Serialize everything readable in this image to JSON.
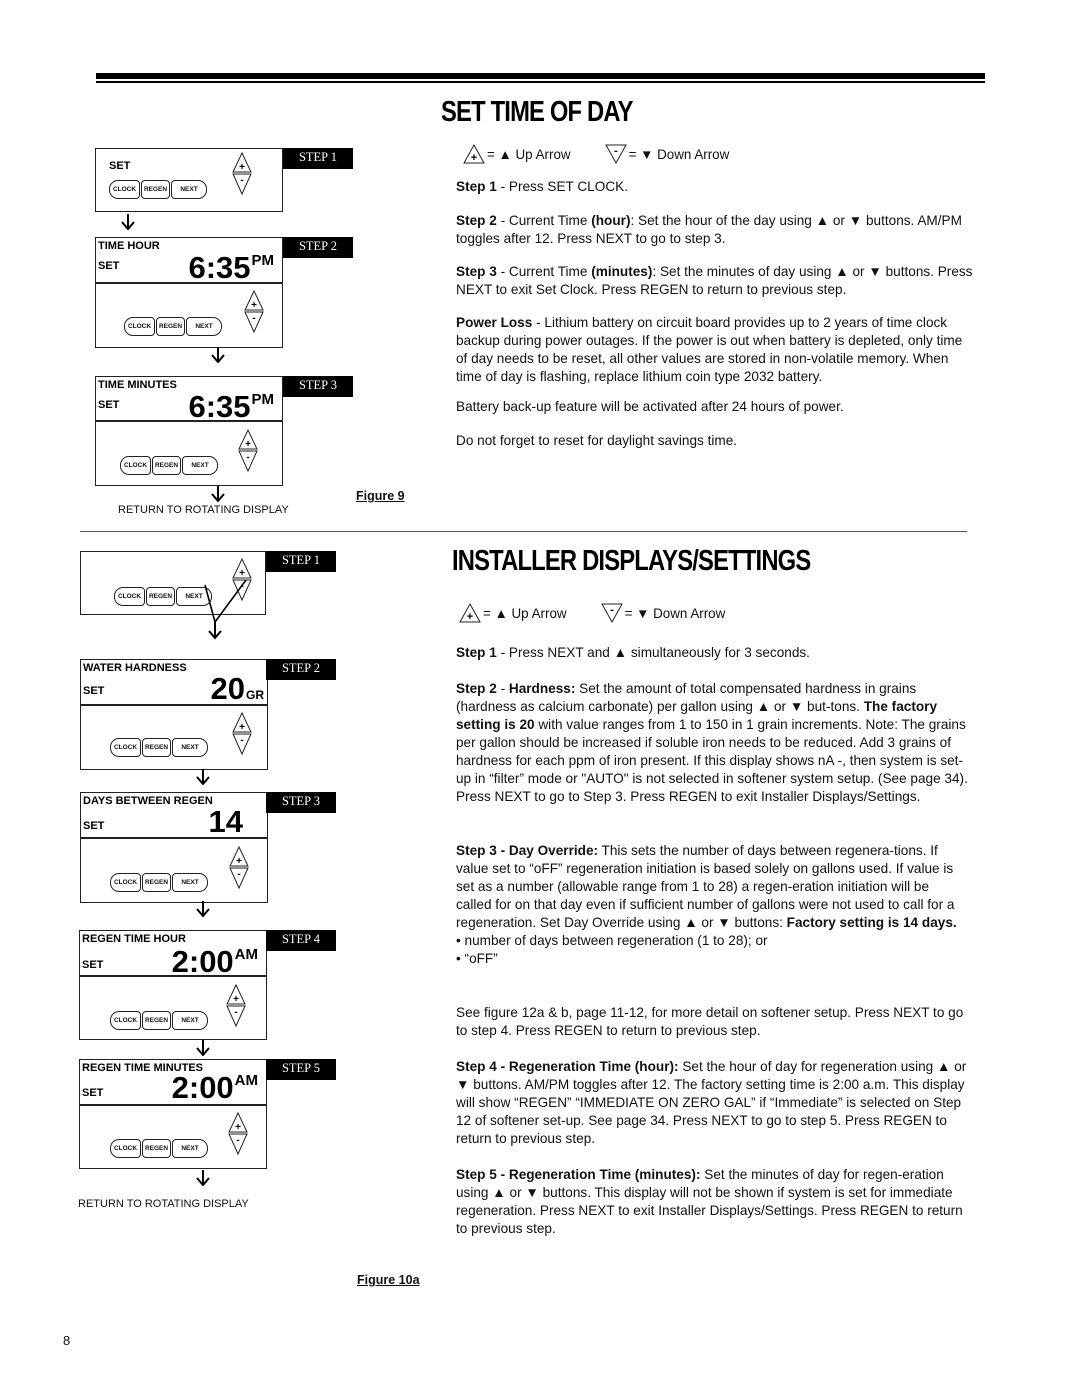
{
  "page_number": "8",
  "legend": {
    "up_label": "= ▲ Up Arrow",
    "down_label": "= ▼ Down Arrow"
  },
  "buttons": {
    "clock": "CLOCK",
    "regen": "REGEN",
    "next": "NEXT",
    "plus": "+",
    "minus": "-"
  },
  "set_time_of_day": {
    "heading": "SET TIME OF DAY",
    "figure_label": "Figure 9",
    "return_text": "RETURN TO ROTATING DISPLAY",
    "panels": [
      {
        "step": "STEP 1",
        "line1": "",
        "line2": "SET",
        "value": "",
        "suffix": ""
      },
      {
        "step": "STEP 2",
        "line1": "TIME  HOUR",
        "line2": "SET",
        "value": "6:35",
        "suffix": "PM"
      },
      {
        "step": "STEP 3",
        "line1": "TIME  MINUTES",
        "line2": "SET",
        "value": "6:35",
        "suffix": "PM"
      }
    ],
    "paragraphs": {
      "step1_label": "Step 1",
      "step1_text": " - Press SET CLOCK.",
      "step2_label": "Step 2",
      "step2_text_a": " - Current Time ",
      "step2_bold": "(hour)",
      "step2_text_b": ": Set the hour of the day using ▲ or ▼ buttons. AM/PM toggles after 12.  Press NEXT to go to step 3.",
      "step3_label": "Step 3",
      "step3_text_a": " - Current Time ",
      "step3_bold": "(minutes)",
      "step3_text_b": ": Set the minutes of day using ▲ or ▼ buttons. Press NEXT to exit Set Clock.  Press REGEN to return to previous step.",
      "power_label": "Power Loss",
      "power_text": " - Lithium battery on circuit board provides up to 2 years of time clock backup during power outages.  If the power is out when battery is depleted, only time of day needs to be reset, all other values are stored in non-volatile memory.  When time of day is flashing, replace lithium coin type 2032 battery.",
      "battery_text": "Battery back-up feature will be activated after 24 hours of power.",
      "dst_text": "Do not forget to reset for daylight savings time."
    }
  },
  "installer": {
    "heading": "INSTALLER DISPLAYS/SETTINGS",
    "figure_label": "Figure 10a",
    "return_text": "RETURN TO ROTATING DISPLAY",
    "panels": [
      {
        "step": "STEP 1",
        "line1": "",
        "line2": "",
        "value": "",
        "suffix": ""
      },
      {
        "step": "STEP 2",
        "line1": "WATER   HARDNESS",
        "line2": "SET",
        "value": "20",
        "suffix": "GR"
      },
      {
        "step": "STEP 3",
        "line1": "DAYS BETWEEN REGEN",
        "line2": "SET",
        "value": "14",
        "suffix": ""
      },
      {
        "step": "STEP 4",
        "line1": "REGEN TIME HOUR",
        "line2": "SET",
        "value": "2:00",
        "suffix": "AM"
      },
      {
        "step": "STEP 5",
        "line1": "REGEN TIME MINUTES",
        "line2": "SET",
        "value": "2:00",
        "suffix": "AM"
      }
    ],
    "paragraphs": {
      "step1_label": "Step 1",
      "step1_text": " - Press NEXT and ▲ simultaneously for 3 seconds.",
      "step2_label": "Step 2",
      "step2_text_a": " - ",
      "step2_bold_a": "Hardness:",
      "step2_text_b": "  Set the amount of total compensated hardness in grains (hardness as calcium carbonate) per gallon using ▲ or ▼ but-tons. ",
      "step2_bold_b": "The factory setting is 20",
      "step2_text_c": " with value ranges from 1 to 150 in 1 grain increments.  Note:  The grains per gallon should be increased if soluble iron needs to be reduced.    Add 3 grains of hardness for each ppm of iron present.  If this display shows nA -, then system is set-up in “filter” mode or \"AUTO\" is not selected in softener system setup.  (See page 34).  Press NEXT to go to Step 3.  Press REGEN to exit Installer Displays/Settings.",
      "step3_bold": "Step 3 - Day Override:",
      "step3_text": "  This sets the number of days between regenera-tions.  If value set to “oFF” regeneration initiation is based solely on gallons used.  If value is set as a number (allowable range from 1 to 28) a regen-eration initiation will be called for on that day even if sufficient number of gallons were not used to call for a regeneration.  Set Day Override using ▲ or ▼ buttons:  ",
      "step3_bold_b": "Factory setting is 14 days.",
      "step3_bullets": [
        "• number of days between regeneration (1 to 28); or",
        "• “oFF”"
      ],
      "see_figure_text": "See figure 12a & b, page 11-12, for more detail on softener setup.  Press NEXT to go to step 4.  Press REGEN to return to previous step.",
      "step4_bold": "Step 4 - Regeneration Time (hour):",
      "step4_text": " Set the hour of day for regeneration using ▲ or ▼ buttons.  AM/PM toggles after 12.  The factory setting time is 2:00 a.m.  This display will show “REGEN” “IMMEDIATE ON ZERO GAL” if “Immediate” is selected on Step 12 of softener set-up.  See page 34.  Press NEXT to go to step 5.  Press REGEN to return to previous step.",
      "step5_bold": "Step 5 - Regeneration Time (minutes):",
      "step5_text": " Set the minutes of day for regen-eration using ▲ or ▼ buttons.  This display will not be shown if system is set for immediate regeneration.  Press NEXT to exit Installer Displays/Settings. Press REGEN to return to previous step."
    }
  }
}
